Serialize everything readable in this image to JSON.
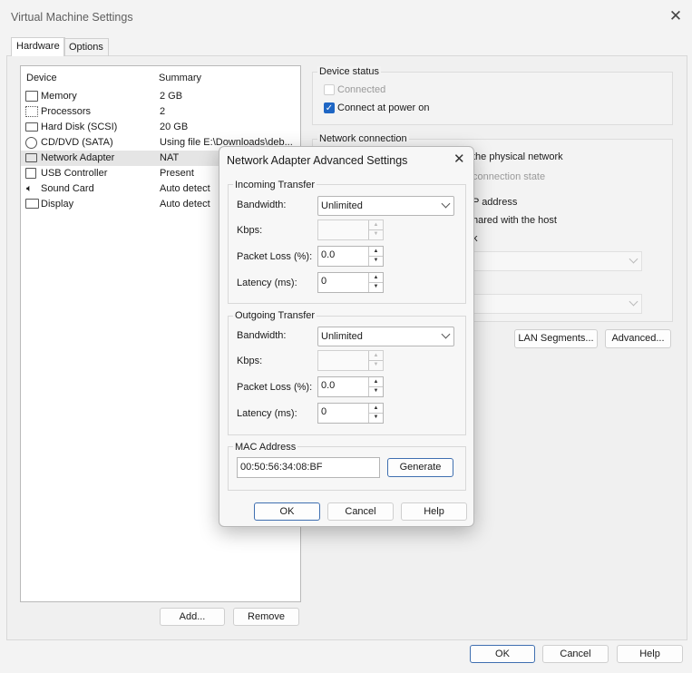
{
  "window": {
    "title": "Virtual Machine Settings"
  },
  "tabs": [
    {
      "label": "Hardware"
    },
    {
      "label": "Options"
    }
  ],
  "device_list": {
    "headers": {
      "device": "Device",
      "summary": "Summary"
    },
    "rows": [
      {
        "name": "Memory",
        "summary": "2 GB",
        "icon": "memory-icon"
      },
      {
        "name": "Processors",
        "summary": "2",
        "icon": "processor-icon"
      },
      {
        "name": "Hard Disk (SCSI)",
        "summary": "20 GB",
        "icon": "hard-disk-icon"
      },
      {
        "name": "CD/DVD (SATA)",
        "summary": "Using file E:\\Downloads\\deb...",
        "icon": "cd-dvd-icon"
      },
      {
        "name": "Network Adapter",
        "summary": "NAT",
        "icon": "network-adapter-icon"
      },
      {
        "name": "USB Controller",
        "summary": "Present",
        "icon": "usb-icon"
      },
      {
        "name": "Sound Card",
        "summary": "Auto detect",
        "icon": "speaker-icon"
      },
      {
        "name": "Display",
        "summary": "Auto detect",
        "icon": "monitor-icon"
      }
    ],
    "add_label": "Add...",
    "remove_label": "Remove"
  },
  "device_status": {
    "title": "Device status",
    "connected": "Connected",
    "connect_power_on": "Connect at power on"
  },
  "network_connection": {
    "title": "Network connection",
    "bridged_partial": "the physical network",
    "replicate_partial": "connection state",
    "nat_partial": "P address",
    "hostonly_partial": "hared with the host",
    "custom_partial": "k",
    "lan_segments_label": "LAN Segments...",
    "advanced_label": "Advanced..."
  },
  "dialog": {
    "title": "Network Adapter Advanced Settings",
    "incoming": {
      "title": "Incoming Transfer",
      "bandwidth_label": "Bandwidth:",
      "bandwidth_value": "Unlimited",
      "kbps_label": "Kbps:",
      "kbps_value": "",
      "packet_loss_label": "Packet Loss (%):",
      "packet_loss_value": "0.0",
      "latency_label": "Latency (ms):",
      "latency_value": "0"
    },
    "outgoing": {
      "title": "Outgoing Transfer",
      "bandwidth_label": "Bandwidth:",
      "bandwidth_value": "Unlimited",
      "kbps_label": "Kbps:",
      "kbps_value": "",
      "packet_loss_label": "Packet Loss (%):",
      "packet_loss_value": "0.0",
      "latency_label": "Latency (ms):",
      "latency_value": "0"
    },
    "mac": {
      "title": "MAC Address",
      "value": "00:50:56:34:08:BF",
      "generate_label": "Generate"
    },
    "ok_label": "OK",
    "cancel_label": "Cancel",
    "help_label": "Help"
  },
  "footer": {
    "ok_label": "OK",
    "cancel_label": "Cancel",
    "help_label": "Help"
  },
  "colors": {
    "accent": "#1e66c4",
    "selected_row": "#e5e5e5"
  }
}
